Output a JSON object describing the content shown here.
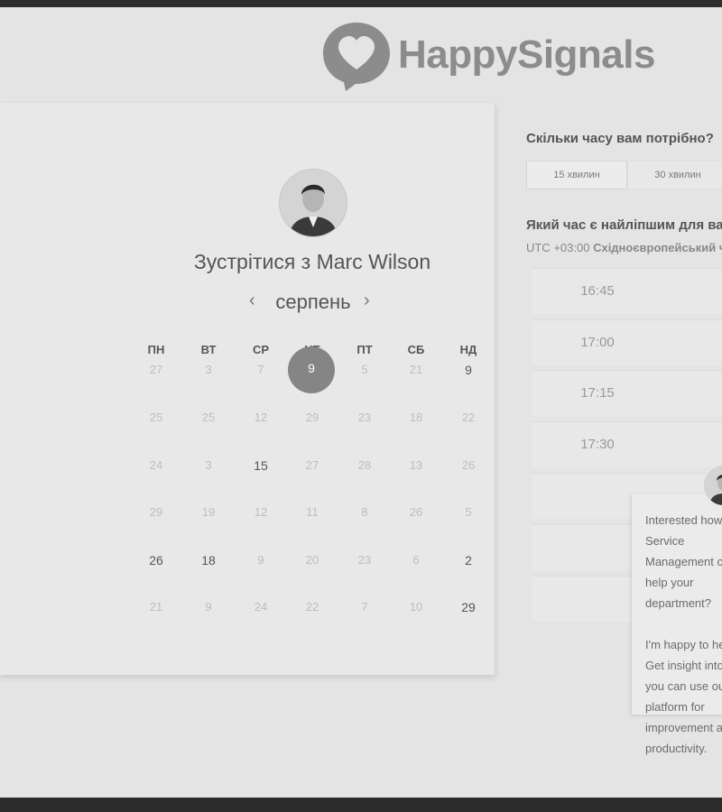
{
  "brand": {
    "name": "HappySignals"
  },
  "host": {
    "title_prefix": "Зустрітися з ",
    "name": "Marc Wilson"
  },
  "calendar": {
    "month": "серпень",
    "weekdays": [
      "ПН",
      "ВТ",
      "СР",
      "ЧТ",
      "ПТ",
      "СБ",
      "НД"
    ],
    "weeks": [
      [
        "27",
        "3",
        "7",
        "9",
        "5",
        "21",
        "9"
      ],
      [
        "25",
        "25",
        "12",
        "29",
        "23",
        "18",
        "22"
      ],
      [
        "24",
        "3",
        "15",
        "27",
        "28",
        "13",
        "26"
      ],
      [
        "29",
        "19",
        "12",
        "11",
        "8",
        "26",
        "5"
      ],
      [
        "26",
        "18",
        "9",
        "20",
        "23",
        "6",
        "2"
      ],
      [
        "21",
        "9",
        "24",
        "22",
        "7",
        "10",
        "29"
      ]
    ],
    "selected_day": "9"
  },
  "duration": {
    "question": "Скільки часу вам потрібно?",
    "options": [
      "15 хвилин",
      "30 хвилин"
    ],
    "selected": "15 хвилин"
  },
  "time": {
    "question": "Який час є найліпшим для вас?",
    "timezone_offset": "UTC +03:00",
    "timezone_name": "Східноєвропейський час",
    "slots": [
      "16:45",
      "17:00",
      "17:15",
      "17:30"
    ]
  },
  "chat": {
    "paragraph1": "Interested how Service Management can help your department?",
    "paragraph2": "I'm happy to help! Get insight into how you can use our platform for improvement and productivity."
  },
  "colors": {
    "accent": "#858585",
    "brand": "#8c8c8c"
  }
}
